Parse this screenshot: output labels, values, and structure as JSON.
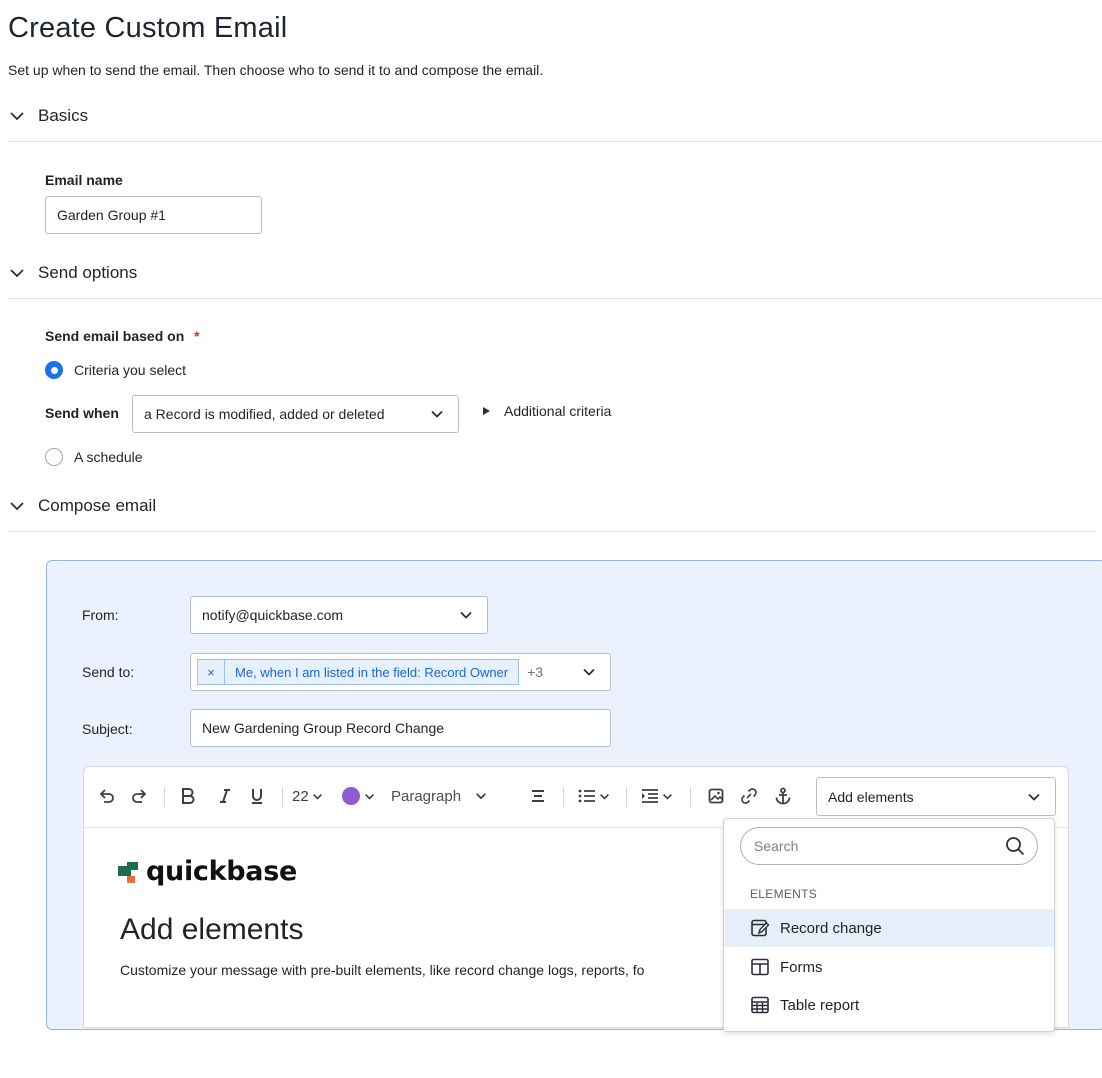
{
  "page": {
    "title": "Create Custom Email",
    "subtitle": "Set up when to send the email. Then choose who to send it to and compose the email."
  },
  "sections": {
    "basics": "Basics",
    "send_options": "Send options",
    "compose": "Compose email"
  },
  "basics": {
    "email_name_label": "Email name",
    "email_name_value": "Garden Group #1"
  },
  "send_options": {
    "based_on_label": "Send email based on",
    "required_mark": "*",
    "option_criteria": "Criteria you select",
    "send_when_label": "Send when",
    "send_when_value": "a Record is modified, added or deleted",
    "additional_criteria": "Additional criteria",
    "option_schedule": "A schedule"
  },
  "compose": {
    "from_label": "From:",
    "from_value": "notify@quickbase.com",
    "send_to_label": "Send to:",
    "recipient_chip_remove": "×",
    "recipient_chip": "Me, when I am listed in the field: Record Owner",
    "recipient_more": "+3",
    "subject_label": "Subject:",
    "subject_value": "New Gardening Group Record Change"
  },
  "toolbar": {
    "font_size": "22",
    "text_color": "#8e5cd1",
    "block_style": "Paragraph",
    "add_elements": "Add elements"
  },
  "editor": {
    "logo_text": "quickbase",
    "heading": "Add elements",
    "body": "Customize your message with pre-built elements, like record change logs, reports, fo"
  },
  "elements_menu": {
    "search_placeholder": "Search",
    "group_label": "ELEMENTS",
    "items": [
      "Record change",
      "Forms",
      "Table report"
    ]
  },
  "colors": {
    "accent": "#1a73e8",
    "panel_bg": "#ebf2fe",
    "logo_green": "#1f6b4f",
    "logo_orange": "#ef6b3a"
  }
}
